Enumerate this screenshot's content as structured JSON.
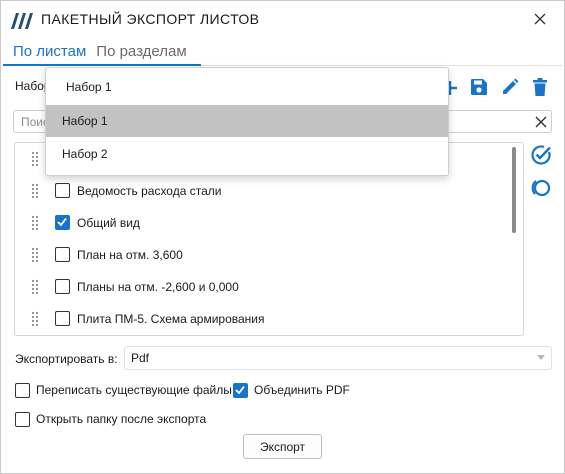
{
  "window": {
    "title": "ПАКЕТНЫЙ ЭКСПОРТ ЛИСТОВ"
  },
  "tabs": [
    {
      "label": "По листам",
      "active": true
    },
    {
      "label": "По разделам",
      "active": false
    }
  ],
  "set_selector": {
    "label": "Набор",
    "current_value": "Набор 1",
    "options": [
      "Набор 1",
      "Набор 2"
    ],
    "selected_option": "Набор 1"
  },
  "toolbar_icons": [
    "add-icon",
    "save-icon",
    "edit-icon",
    "delete-icon"
  ],
  "search": {
    "placeholder": "Поиск",
    "clear_icon": "close-icon"
  },
  "sheet_list": {
    "items": [
      {
        "label": "",
        "checked": false
      },
      {
        "label": "Ведомость расхода стали",
        "checked": false
      },
      {
        "label": "Общий вид",
        "checked": true
      },
      {
        "label": "План на отм. 3,600",
        "checked": false
      },
      {
        "label": "Планы на отм. -2,600 и 0,000",
        "checked": false
      },
      {
        "label": "Плита ПМ-5. Схема армирования",
        "checked": false
      }
    ]
  },
  "side_tools": [
    "check-all-icon",
    "uncheck-all-icon"
  ],
  "export": {
    "label": "Экспортировать в:",
    "value": "Pdf"
  },
  "options": {
    "overwrite_label": "Переписать существующие файлы",
    "overwrite_checked": false,
    "merge_pdf_label": "Объединить PDF",
    "merge_pdf_checked": true,
    "open_folder_label": "Открыть папку после экспорта",
    "open_folder_checked": false
  },
  "export_button": {
    "label": "Экспорт"
  },
  "colors": {
    "accent": "#1a73c4",
    "dropdown_selected": "#c2c2c2",
    "text": "#1a1a1a"
  }
}
